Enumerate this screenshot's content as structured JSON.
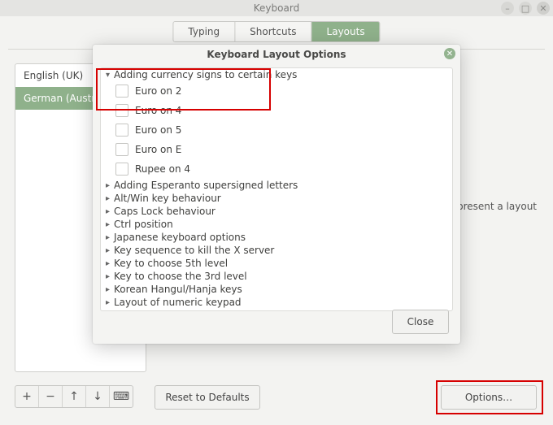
{
  "window": {
    "title": "Keyboard",
    "control_minimize": "–",
    "control_maximize": "□",
    "control_close": "✕"
  },
  "tabs": {
    "typing": "Typing",
    "shortcuts": "Shortcuts",
    "layouts": "Layouts"
  },
  "layouts_list": {
    "item0": "English (UK)",
    "item1": "German (Austria)"
  },
  "hint_text": "epresent a layout",
  "list_tools": {
    "add": "+",
    "remove": "−",
    "up": "↑",
    "down": "↓",
    "kbd": "⌨"
  },
  "buttons": {
    "reset": "Reset to Defaults",
    "options": "Options…"
  },
  "dialog": {
    "title": "Keyboard Layout Options",
    "close_glyph": "✕",
    "expanded_group": "Adding currency signs to certain keys",
    "options": {
      "o0": "Euro on 2",
      "o1": "Euro on 4",
      "o2": "Euro on 5",
      "o3": "Euro on E",
      "o4": "Rupee on 4"
    },
    "collapsed": {
      "c0": "Adding Esperanto supersigned letters",
      "c1": "Alt/Win key behaviour",
      "c2": "Caps Lock behaviour",
      "c3": "Ctrl position",
      "c4": "Japanese keyboard options",
      "c5": "Key sequence to kill the X server",
      "c6": "Key to choose 5th level",
      "c7": "Key to choose the 3rd level",
      "c8": "Korean Hangul/Hanja keys",
      "c9": "Layout of numeric keypad"
    },
    "close_button": "Close"
  }
}
